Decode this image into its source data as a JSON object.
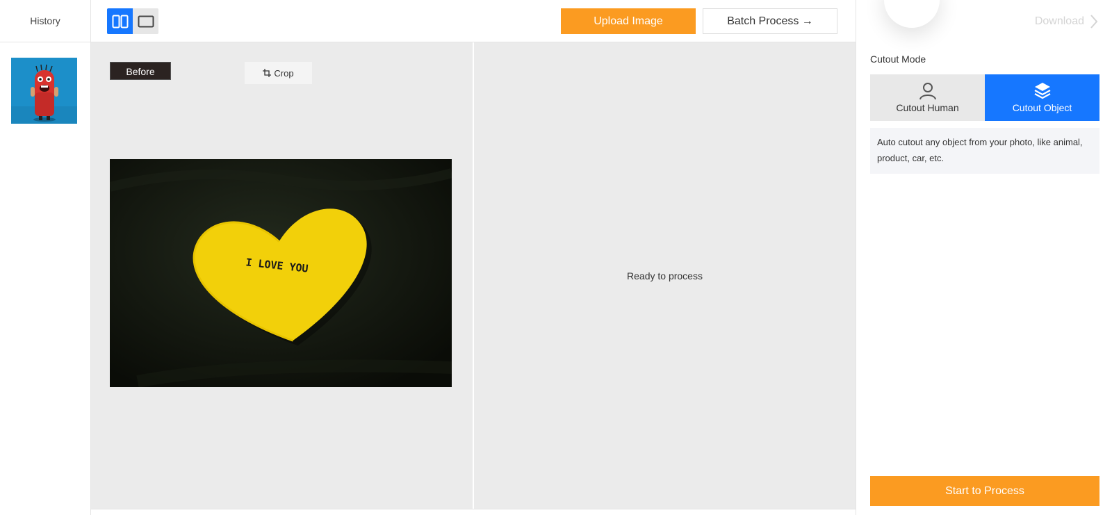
{
  "history": {
    "title": "History",
    "thumbnail_icon": "red-monster-thumbnail"
  },
  "toolbar": {
    "view_split_icon": "split-view-icon",
    "view_single_icon": "single-view-icon",
    "upload_label": "Upload Image",
    "batch_label": "Batch Process →"
  },
  "workspace": {
    "before_label": "Before",
    "crop_label": "Crop",
    "heart_text": "I LOVE YOU",
    "ready_text": "Ready to process"
  },
  "panel": {
    "download_label": "Download",
    "cutout_mode_label": "Cutout Mode",
    "modes": [
      {
        "label": "Cutout Human",
        "icon": "person-icon",
        "active": false
      },
      {
        "label": "Cutout Object",
        "icon": "layers-icon",
        "active": true
      }
    ],
    "description": "Auto cutout any object from your photo, like animal, product, car, etc.",
    "start_label": "Start to Process"
  },
  "colors": {
    "accent_orange": "#fb9b21",
    "accent_blue": "#1677ff",
    "workspace_bg": "#ebebeb"
  }
}
